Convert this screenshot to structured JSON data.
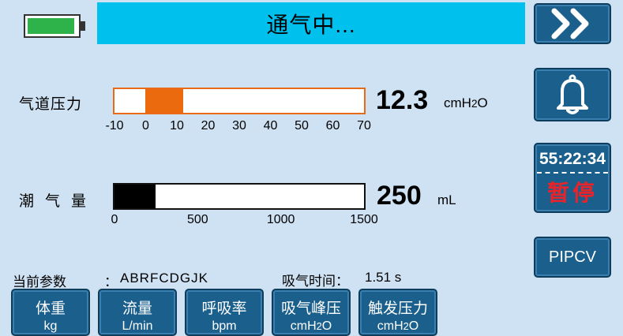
{
  "status": {
    "text": "通气中..."
  },
  "battery": {
    "level": 0.9,
    "color": "#2db34a"
  },
  "right_panel": {
    "next_icon": "double-chevron-right-icon",
    "alarm_icon": "bell-icon",
    "timer": {
      "time": "55:22:34",
      "pause_label": "暂停"
    },
    "mode": "PIPCV"
  },
  "pressure": {
    "label": "气道压力",
    "value": "12.3",
    "unit": "cmH2O",
    "scale_min": -10,
    "scale_max": 70,
    "ticks": [
      "-10",
      "0",
      "10",
      "20",
      "30",
      "40",
      "50",
      "60",
      "70"
    ],
    "fill_from": 0,
    "fill_to": 12.3,
    "color": "#ec6a0e"
  },
  "volume": {
    "label": "潮气量",
    "value": "250",
    "unit": "mL",
    "scale_min": 0,
    "scale_max": 1500,
    "ticks": [
      "0",
      "500",
      "1000",
      "1500"
    ],
    "fill_to": 250
  },
  "params": {
    "label": "当前参数",
    "colon": "：",
    "value": "ABRFCDGJK",
    "insp_time_label": "吸气时间：",
    "insp_time_value": "1.51 s"
  },
  "param_buttons": [
    {
      "label": "体重",
      "unit": "kg"
    },
    {
      "label": "流量",
      "unit": "L/min"
    },
    {
      "label": "呼吸率",
      "unit": "bpm"
    },
    {
      "label": "吸气峰压",
      "unit": "cmH2O"
    },
    {
      "label": "触发压力",
      "unit": "cmH2O"
    }
  ]
}
